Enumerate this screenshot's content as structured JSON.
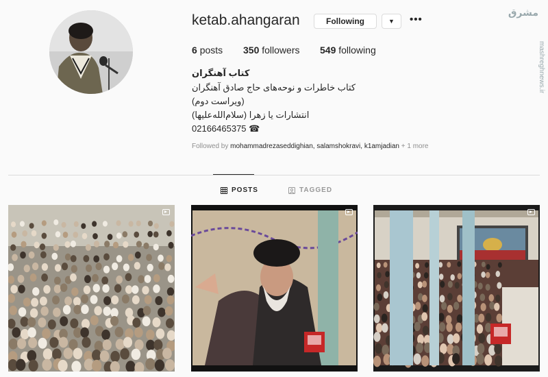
{
  "profile": {
    "username": "ketab.ahangaran",
    "following_button": "Following",
    "dropdown_glyph": "▼",
    "more_glyph": "•••",
    "stats": {
      "posts_count": "6",
      "posts_label": "posts",
      "followers_count": "350",
      "followers_label": "followers",
      "following_count": "549",
      "following_label": "following"
    },
    "bio": {
      "name": "کتاب آهنگران",
      "line1": "کتاب خاطرات و نوحه‌های حاج صادق آهنگران",
      "line2": "(ویراست دوم)",
      "line3": "انتشارات یا زهرا (سلام‌الله‌علیها)",
      "phone": "02166465375 ☎"
    },
    "followed_by": {
      "prefix": "Followed by",
      "users": [
        "mohammadrezaseddighian,",
        "salamshokravi,",
        "k1amjadian"
      ],
      "suffix": "+ 1 more"
    }
  },
  "tabs": {
    "posts": "POSTS",
    "tagged": "TAGGED"
  },
  "watermark": {
    "logo": "مشرق",
    "side": "mashreghnews.ir"
  },
  "colors": {
    "border": "#dbdbdb",
    "text": "#262626",
    "muted": "#8e8e8e",
    "bg": "#fafafa"
  },
  "posts": [
    {
      "type": "video",
      "icon": "video-icon"
    },
    {
      "type": "video",
      "icon": "video-icon"
    },
    {
      "type": "video",
      "icon": "video-icon"
    }
  ]
}
